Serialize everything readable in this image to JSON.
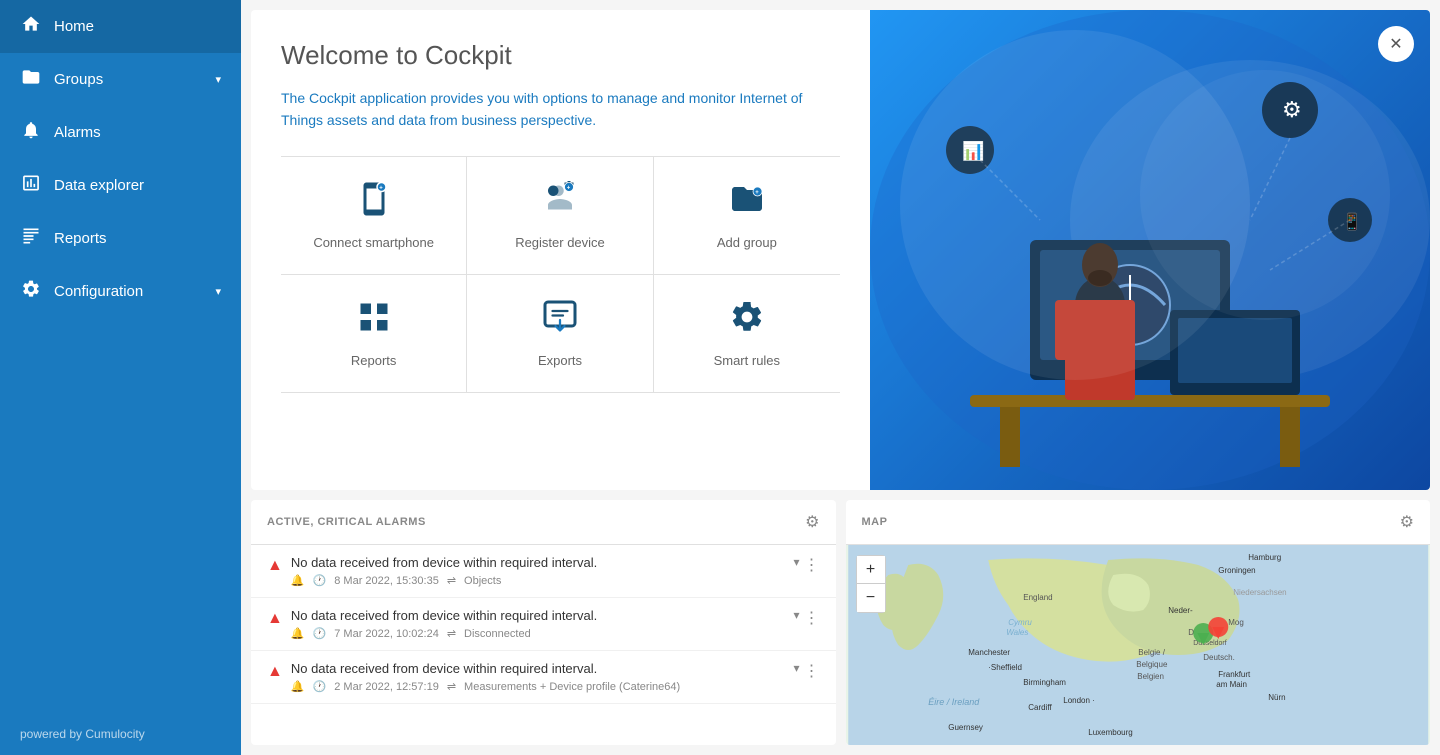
{
  "sidebar": {
    "items": [
      {
        "id": "home",
        "label": "Home",
        "icon": "home",
        "active": true
      },
      {
        "id": "groups",
        "label": "Groups",
        "icon": "folder",
        "hasArrow": true
      },
      {
        "id": "alarms",
        "label": "Alarms",
        "icon": "bell"
      },
      {
        "id": "data-explorer",
        "label": "Data explorer",
        "icon": "chart"
      },
      {
        "id": "reports",
        "label": "Reports",
        "icon": "reports"
      },
      {
        "id": "configuration",
        "label": "Configuration",
        "icon": "gear",
        "hasArrow": true
      }
    ],
    "footer": "powered by Cumulocity"
  },
  "welcome": {
    "title": "Welcome to Cockpit",
    "description": "The Cockpit application provides you with options to manage and monitor Internet of Things assets and data from business perspective.",
    "quickLinks": [
      {
        "id": "connect-smartphone",
        "label": "Connect smartphone",
        "icon": "smartphone"
      },
      {
        "id": "register-device",
        "label": "Register device",
        "icon": "device"
      },
      {
        "id": "add-group",
        "label": "Add group",
        "icon": "group"
      },
      {
        "id": "reports",
        "label": "Reports",
        "icon": "grid"
      },
      {
        "id": "exports",
        "label": "Exports",
        "icon": "exports"
      },
      {
        "id": "smart-rules",
        "label": "Smart rules",
        "icon": "smart-rules"
      }
    ]
  },
  "alarmsPanel": {
    "title": "ACTIVE, CRITICAL ALARMS",
    "alarms": [
      {
        "id": 1,
        "title": "No data received from device within required interval.",
        "date": "8 Mar 2022, 15:30:35",
        "connection": "Objects"
      },
      {
        "id": 2,
        "title": "No data received from device within required interval.",
        "date": "7 Mar 2022, 10:02:24",
        "connection": "Disconnected"
      },
      {
        "id": 3,
        "title": "No data received from device within required interval.",
        "date": "2 Mar 2022, 12:57:19",
        "connection": "Measurements + Device profile (Caterine64)"
      }
    ]
  },
  "mapPanel": {
    "title": "MAP",
    "zoomIn": "+",
    "zoomOut": "−",
    "locations": [
      {
        "city": "Düsseldorf",
        "lat": 51.2,
        "lng": 6.78
      }
    ]
  }
}
